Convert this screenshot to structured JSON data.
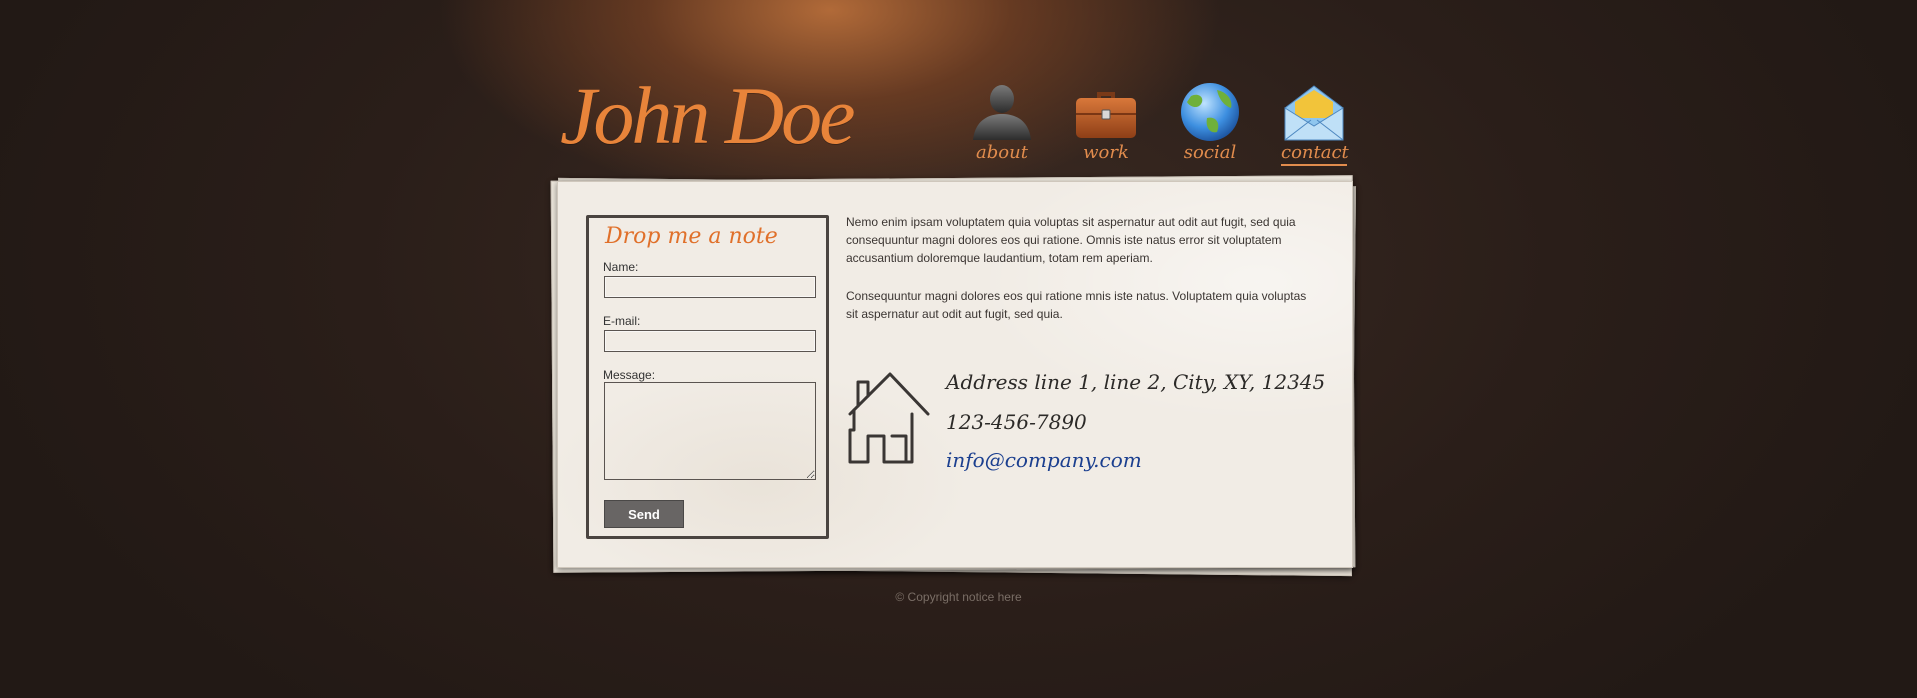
{
  "colors": {
    "accent": "#e8843a",
    "nav_label": "#e18c4d",
    "form_title": "#e0702a",
    "email_link": "#1b3f8f",
    "paper": "#f1ece5",
    "background": "#2a1e19"
  },
  "header": {
    "logo_text": "John Doe"
  },
  "nav": {
    "items": [
      {
        "label": "about",
        "icon": "person-icon"
      },
      {
        "label": "work",
        "icon": "briefcase-icon"
      },
      {
        "label": "social",
        "icon": "globe-icon"
      },
      {
        "label": "contact",
        "icon": "envelope-icon",
        "active": true
      }
    ]
  },
  "form": {
    "title": "Drop me a note",
    "name_label": "Name:",
    "name_value": "",
    "email_label": "E-mail:",
    "email_value": "",
    "message_label": "Message:",
    "message_value": "",
    "send_label": "Send"
  },
  "content": {
    "paragraph_1": "Nemo enim ipsam voluptatem quia voluptas sit aspernatur aut odit aut fugit, sed quia consequuntur magni dolores eos qui ratione. Omnis iste natus error sit voluptatem accusantium doloremque laudantium, totam rem aperiam.",
    "paragraph_2": "Consequuntur magni dolores eos qui ratione mnis iste natus. Voluptatem quia voluptas sit aspernatur aut odit aut fugit, sed quia."
  },
  "contact": {
    "icon": "house-icon",
    "address": "Address line 1, line 2, City, XY, 12345",
    "phone": "123-456-7890",
    "email": "info@company.com"
  },
  "footer": {
    "copyright": "© Copyright notice here"
  }
}
